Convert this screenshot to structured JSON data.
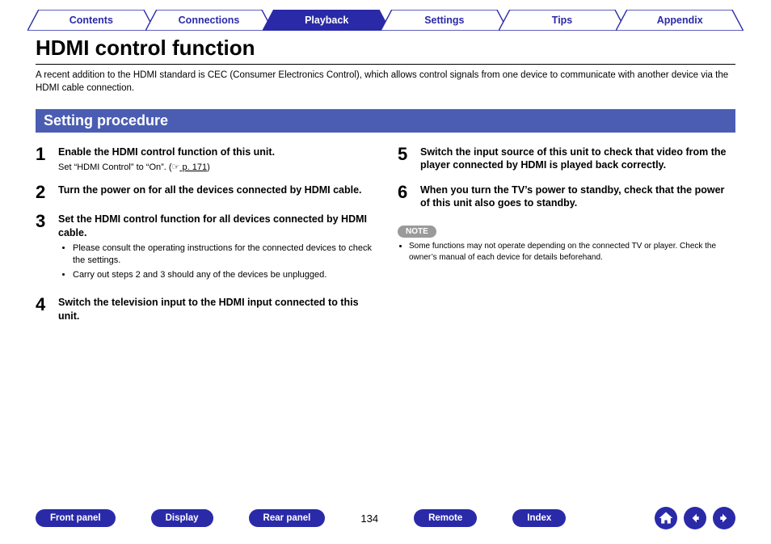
{
  "tabs": [
    {
      "label": "Contents",
      "active": false
    },
    {
      "label": "Connections",
      "active": false
    },
    {
      "label": "Playback",
      "active": true
    },
    {
      "label": "Settings",
      "active": false
    },
    {
      "label": "Tips",
      "active": false
    },
    {
      "label": "Appendix",
      "active": false
    }
  ],
  "title": "HDMI control function",
  "intro": "A recent addition to the HDMI standard is CEC (Consumer Electronics Control), which allows control signals from one device to communicate with another device via the HDMI cable connection.",
  "section_heading": "Setting procedure",
  "steps_left": [
    {
      "num": "1",
      "title": "Enable the HDMI control function of this unit.",
      "sub_prefix": "Set “HDMI Control” to “On”.  (",
      "sub_hand": "☞",
      "sub_link": " p. 171",
      "sub_suffix": ")"
    },
    {
      "num": "2",
      "title": "Turn the power on for all the devices connected by HDMI cable."
    },
    {
      "num": "3",
      "title": "Set the HDMI control function for all devices connected by HDMI cable.",
      "bullets": [
        "Please consult the operating instructions for the connected devices to check the settings.",
        "Carry out steps 2 and 3 should any of the devices be unplugged."
      ]
    },
    {
      "num": "4",
      "title": "Switch the television input to the HDMI input connected to this unit."
    }
  ],
  "steps_right": [
    {
      "num": "5",
      "title": "Switch the input source of this unit to check that video from the player connected by HDMI is played back correctly."
    },
    {
      "num": "6",
      "title": "When you turn the TV’s power to standby, check that the power of this unit also goes to standby."
    }
  ],
  "note_label": "NOTE",
  "note_items": [
    "Some functions may not operate depending on the connected TV or player. Check the owner’s manual of each device for details beforehand."
  ],
  "footer": {
    "buttons_left": [
      "Front panel",
      "Display",
      "Rear panel"
    ],
    "page": "134",
    "buttons_right": [
      "Remote",
      "Index"
    ]
  }
}
